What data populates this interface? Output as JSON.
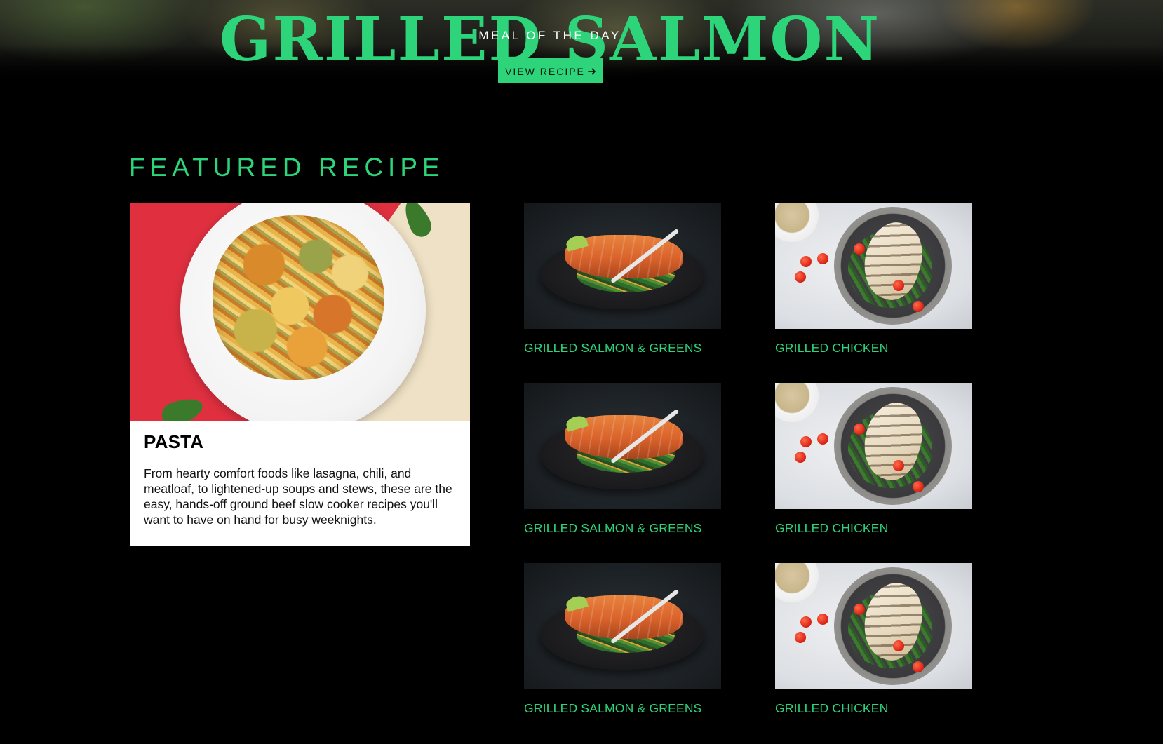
{
  "hero": {
    "title": "GRILLED SALMON",
    "subtitle": "MEAL OF THE DAY",
    "button_label": "VIEW RECIPE"
  },
  "featured": {
    "section_title": "FEATURED RECIPE",
    "card": {
      "title": "PASTA",
      "description": "From hearty comfort foods like lasagna, chili, and meatloaf, to lightened-up soups and stews, these are the easy, hands-off ground beef slow cooker recipes you'll want to have on hand for busy weeknights."
    }
  },
  "recipes": [
    {
      "title": "GRILLED SALMON & GREENS"
    },
    {
      "title": "GRILLED CHICKEN"
    },
    {
      "title": "GRILLED SALMON & GREENS"
    },
    {
      "title": "GRILLED CHICKEN"
    },
    {
      "title": "GRILLED SALMON & GREENS"
    },
    {
      "title": "GRILLED CHICKEN"
    }
  ],
  "colors": {
    "accent": "#2ed47a",
    "background": "#000000",
    "card_background": "#ffffff"
  }
}
